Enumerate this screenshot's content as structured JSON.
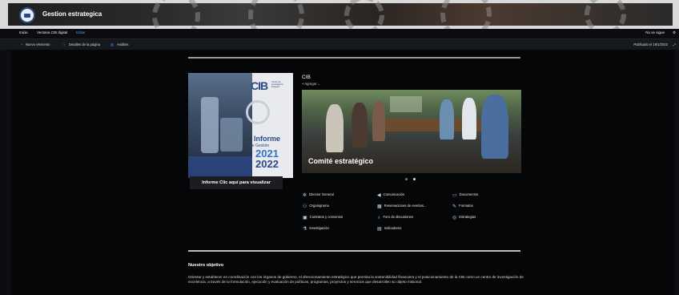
{
  "header": {
    "site_title": "Gestion estrategica"
  },
  "nav": {
    "items": [
      {
        "label": "Inicio"
      },
      {
        "label": "Ventana CIB digital"
      },
      {
        "label": "Editar"
      }
    ],
    "follow_label": "No se sigue",
    "share_label": "⚙"
  },
  "commandbar": {
    "new_label": "Nuevo elemento",
    "page_details_label": "Detalles de la página",
    "analytics_label": "Análisis",
    "published_label": "Publicado el 19/1/2022"
  },
  "cover": {
    "logo": "CIB",
    "logo_small": "Centro de investigación biológica",
    "title1": "Informe",
    "title2": "de Gestión",
    "year1": "2021",
    "year2": "2022",
    "cta": "Informe Clic aquí para visualizar"
  },
  "webpart": {
    "title": "CIB",
    "add_label": "Agregar",
    "hero_caption": "Comité estratégico"
  },
  "quicklinks": [
    {
      "label": "Director General",
      "icon": "person-network-icon"
    },
    {
      "label": "Comunicación",
      "icon": "megaphone-icon"
    },
    {
      "label": "Documentos",
      "icon": "folder-icon"
    },
    {
      "label": "Organigrama",
      "icon": "org-chart-icon"
    },
    {
      "label": "Reservaciones de eventos...",
      "icon": "calendar-icon"
    },
    {
      "label": "Formatos",
      "icon": "edit-form-icon"
    },
    {
      "label": "Contratos y convenios",
      "icon": "contract-icon"
    },
    {
      "label": "Foro de discusiones",
      "icon": "lightbulb-icon"
    },
    {
      "label": "Estrategias",
      "icon": "target-icon"
    },
    {
      "label": "Investigación",
      "icon": "flask-icon"
    },
    {
      "label": "Indicadores",
      "icon": "chart-icon"
    }
  ],
  "objective": {
    "title": "Nuestro objetivo",
    "text": "Orientar y establecer en coordinación con los órganos de gobierno, el direccionamiento estratégico que permita la sostenibilidad financiera y el posicionamiento de la CIB como un centro de investigación de excelencia, a través de la formulación, ejecución y evaluación de políticas, programas, proyectos y servicios que desarrollen su objeto misional."
  }
}
